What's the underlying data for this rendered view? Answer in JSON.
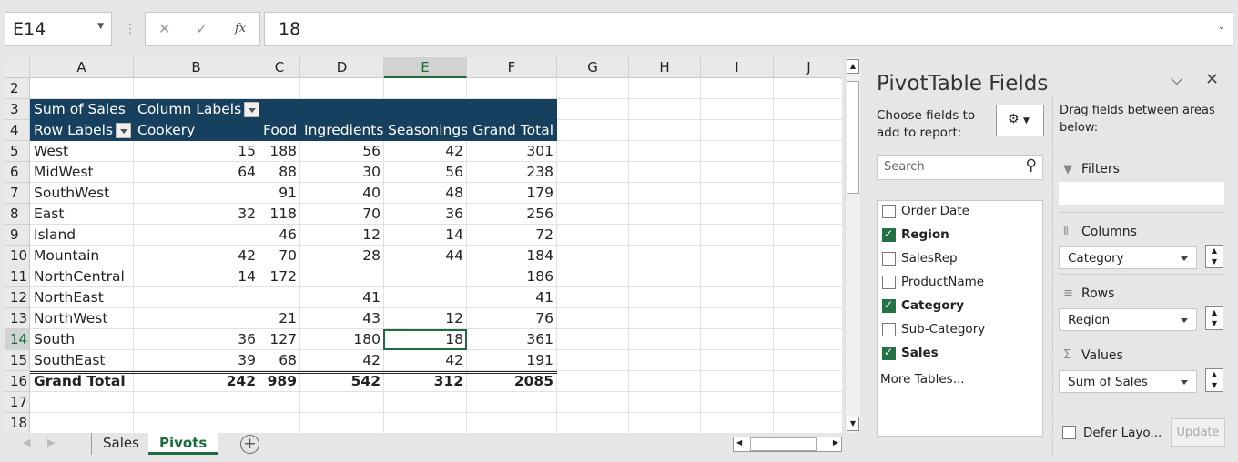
{
  "name_box": "E14",
  "formula_bar": {
    "cancel": "✕",
    "enter": "✓",
    "fx": "fx",
    "value": "18"
  },
  "columns": [
    "A",
    "B",
    "C",
    "D",
    "E",
    "F",
    "G",
    "H",
    "I",
    "J"
  ],
  "rows": [
    "2",
    "3",
    "4",
    "5",
    "6",
    "7",
    "8",
    "9",
    "10",
    "11",
    "12",
    "13",
    "14",
    "15",
    "16",
    "17",
    "18"
  ],
  "pivot": {
    "data_field": "Sum of Sales",
    "column_labels": "Column Labels",
    "row_labels": "Row Labels",
    "headers": [
      "Cookery",
      "Food",
      "Ingredients",
      "Seasonings",
      "Grand Total"
    ],
    "body": [
      [
        "West",
        "15",
        "188",
        "56",
        "42",
        "301"
      ],
      [
        "MidWest",
        "64",
        "88",
        "30",
        "56",
        "238"
      ],
      [
        "SouthWest",
        "",
        "91",
        "40",
        "48",
        "179"
      ],
      [
        "East",
        "32",
        "118",
        "70",
        "36",
        "256"
      ],
      [
        "Island",
        "",
        "46",
        "12",
        "14",
        "72"
      ],
      [
        "Mountain",
        "42",
        "70",
        "28",
        "44",
        "184"
      ],
      [
        "NorthCentral",
        "14",
        "172",
        "",
        "",
        "186"
      ],
      [
        "NorthEast",
        "",
        "",
        "41",
        "",
        "41"
      ],
      [
        "NorthWest",
        "",
        "21",
        "43",
        "12",
        "76"
      ],
      [
        "South",
        "36",
        "127",
        "180",
        "18",
        "361"
      ],
      [
        "SouthEast",
        "39",
        "68",
        "42",
        "42",
        "191"
      ]
    ],
    "total": [
      "Grand Total",
      "242",
      "989",
      "542",
      "312",
      "2085"
    ],
    "header_color": "#17405e"
  },
  "sheet_tabs": [
    "Sales",
    "Pivots"
  ],
  "active_tab": "Pivots",
  "panel": {
    "title": "PivotTable Fields",
    "choose_label": "Choose fields to add to report:",
    "drag_label": "Drag fields between areas below:",
    "search_placeholder": "Search",
    "fields": [
      {
        "name": "Order Date",
        "checked": false
      },
      {
        "name": "Region",
        "checked": true
      },
      {
        "name": "SalesRep",
        "checked": false
      },
      {
        "name": "ProductName",
        "checked": false
      },
      {
        "name": "Category",
        "checked": true
      },
      {
        "name": "Sub-Category",
        "checked": false
      },
      {
        "name": "Sales",
        "checked": true
      }
    ],
    "more_tables": "More Tables...",
    "filters_label": "Filters",
    "columns_label": "Columns",
    "columns_value": "Category",
    "rows_label": "Rows",
    "rows_value": "Region",
    "values_label": "Values",
    "values_value": "Sum of Sales",
    "defer_label": "Defer Layo...",
    "update_label": "Update"
  }
}
